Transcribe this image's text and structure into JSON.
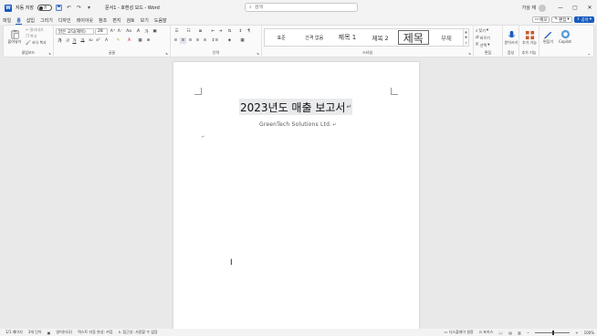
{
  "titlebar": {
    "autosave_label": "자동 저장",
    "autosave_state": "끔",
    "doc_title": "문서1 - 호환성 모드 - Word",
    "search_placeholder": "검색",
    "user_name": "가상 재"
  },
  "tabs": [
    "파일",
    "홈",
    "삽입",
    "그리기",
    "디자인",
    "레이아웃",
    "참조",
    "편지",
    "검토",
    "보기",
    "도움말"
  ],
  "tab_actions": {
    "comments": "메모",
    "editing": "편집",
    "share": "공유"
  },
  "ribbon": {
    "clipboard": {
      "paste": "붙여넣기",
      "cut": "잘라내기",
      "copy": "복사",
      "format_painter": "서식 복사",
      "label": "클립보드"
    },
    "font": {
      "name": "맑은 고딕(제목)",
      "size": "28",
      "label": "글꼴"
    },
    "paragraph": {
      "label": "단락"
    },
    "styles": {
      "items": [
        "표준",
        "간격 없음",
        "제목 1",
        "제목 2",
        "제목",
        "부제"
      ],
      "selected": "제목",
      "label": "스타일"
    },
    "editing": {
      "find": "찾기",
      "replace": "바꾸기",
      "select": "선택",
      "label": "편집"
    },
    "voice": {
      "dictate": "받아쓰기",
      "label": "음성"
    },
    "addins": {
      "addins": "추가 기능",
      "label": "추가 기능"
    },
    "editor": {
      "label": "편집기"
    },
    "copilot": {
      "label": "Copilot"
    }
  },
  "document": {
    "heading": "2023년도 매출 보고서",
    "subtitle": "GreenTech Solutions Ltd."
  },
  "statusbar": {
    "page": "1/1 페이지",
    "words": "3개 단어",
    "language": "영어(미국)",
    "autocorrect": "텍스트 자동 완성: 켜짐",
    "accessibility": "접근성: 사용할 수 없음",
    "focus": "디스플레이 설정",
    "focus_mode": "포커스",
    "zoom": "100%"
  }
}
